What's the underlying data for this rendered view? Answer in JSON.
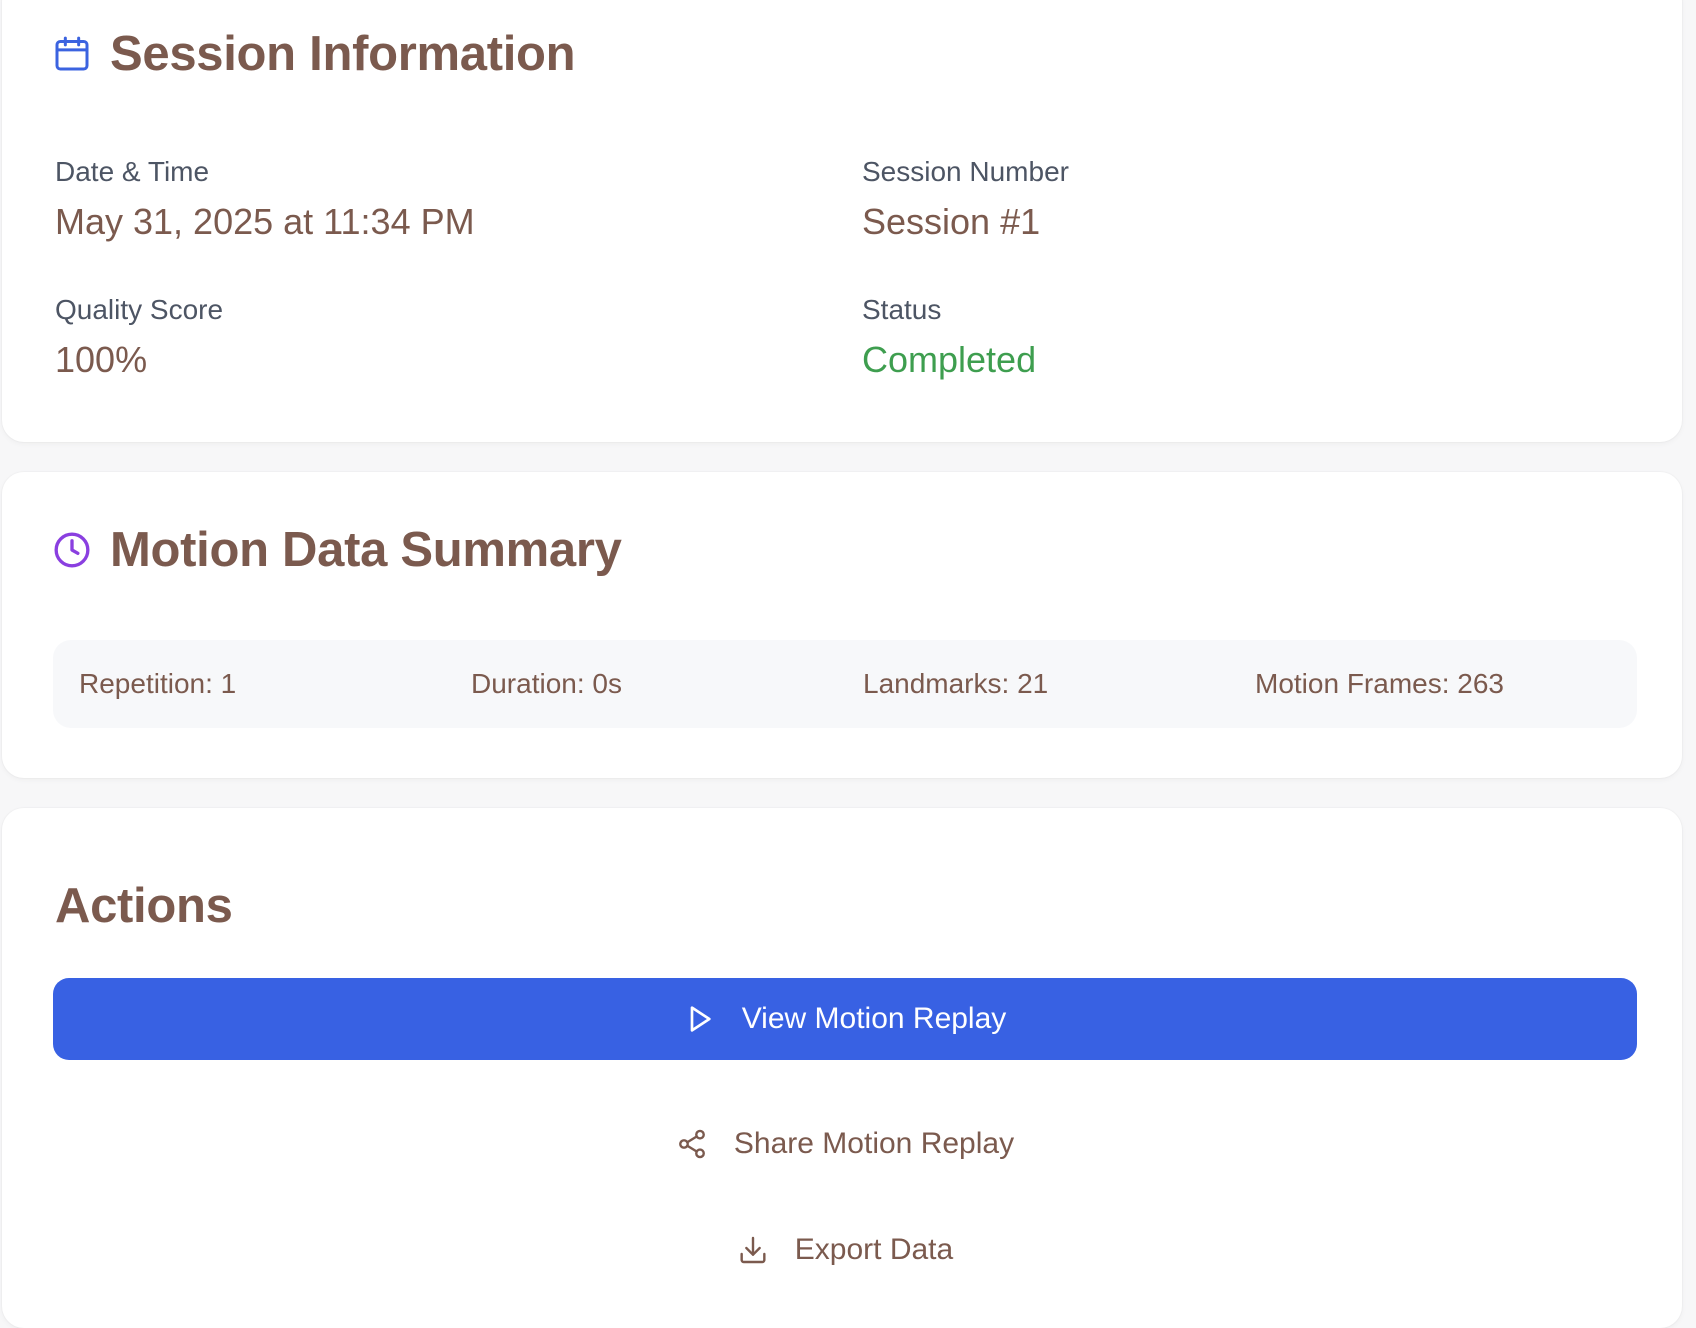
{
  "session_info": {
    "title": "Session Information",
    "icon": "calendar-icon",
    "icon_color": "#3b63e0",
    "fields": [
      {
        "label": "Date & Time",
        "value": "May 31, 2025 at 11:34 PM"
      },
      {
        "label": "Session Number",
        "value": "Session #1"
      },
      {
        "label": "Quality Score",
        "value": "100%"
      },
      {
        "label": "Status",
        "value": "Completed",
        "color": "#3e9e4f"
      }
    ]
  },
  "motion_summary": {
    "title": "Motion Data Summary",
    "icon": "clock-icon",
    "icon_color": "#8a3fe0",
    "items": [
      "Repetition: 1",
      "Duration: 0s",
      "Landmarks: 21",
      "Motion Frames: 263"
    ]
  },
  "actions": {
    "title": "Actions",
    "view_replay_label": "View Motion Replay",
    "view_replay_icon": "play-icon",
    "primary_color": "#3861e3",
    "share_label": "Share Motion Replay",
    "share_icon": "share-icon",
    "export_label": "Export Data",
    "export_icon": "download-icon"
  },
  "colors": {
    "heading": "#7b5a4e",
    "label": "#4d5564",
    "success": "#3e9e4f"
  }
}
